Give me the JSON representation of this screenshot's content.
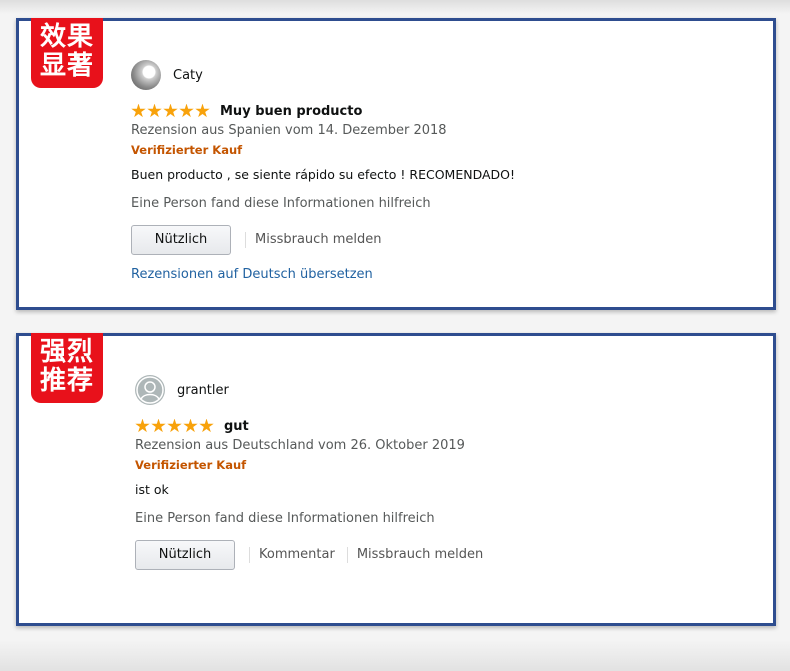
{
  "reviews": [
    {
      "badge": [
        "效果",
        "显著"
      ],
      "name": "Caty",
      "rating": 5,
      "title": "Muy buen producto",
      "date": "Rezension aus Spanien vom 14. Dezember 2018",
      "verified": "Verifizierter Kauf",
      "body": "Buen producto , se siente rápido su efecto ! RECOMENDADO!",
      "helpful": "Eine Person fand diese Informationen hilfreich",
      "helpful_button": "Nützlich",
      "report": "Missbrauch melden",
      "translate": "Rezensionen auf Deutsch übersetzen"
    },
    {
      "badge": [
        "强烈",
        "推荐"
      ],
      "name": "grantler",
      "rating": 5,
      "title": "gut",
      "date": "Rezension aus Deutschland vom 26. Oktober 2019",
      "verified": "Verifizierter Kauf",
      "body": "ist ok",
      "helpful": "Eine Person fand diese Informationen hilfreich",
      "helpful_button": "Nützlich",
      "comment": "Kommentar",
      "report": "Missbrauch melden"
    }
  ],
  "colors": {
    "frame": "#2e4d8f",
    "badge": "#e8111b",
    "star": "#f8a20b",
    "verified": "#c45500",
    "link": "#2162a1"
  },
  "icons": {
    "rating": "star-icon",
    "avatar_default": "default-user-icon"
  }
}
